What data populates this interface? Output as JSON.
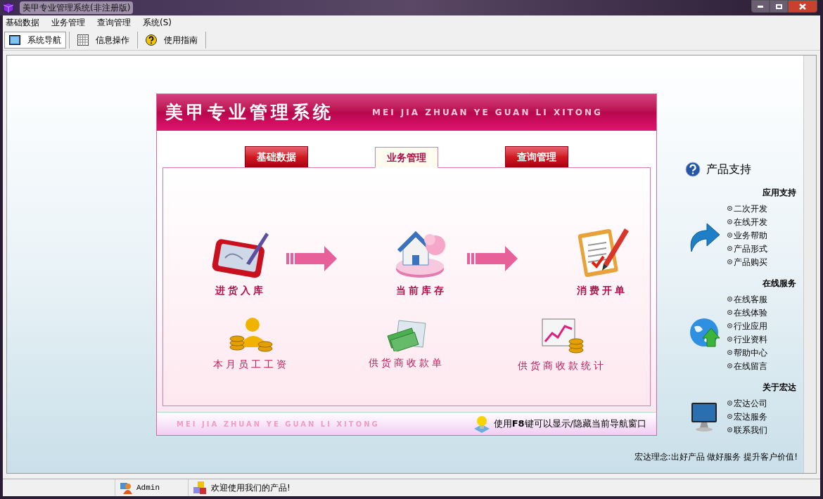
{
  "window": {
    "title": "美甲专业管理系统(非注册版)"
  },
  "menu_bar": [
    "基础数据",
    "业务管理",
    "查询管理",
    "系统(S)"
  ],
  "toolbar": [
    {
      "label": "系统导航",
      "kind": "window",
      "selected": true
    },
    {
      "label": "信息操作",
      "kind": "grid",
      "selected": false
    },
    {
      "label": "使用指南",
      "kind": "help",
      "selected": false
    }
  ],
  "panel": {
    "title": "美甲专业管理系统",
    "title_pinyin": "MEI JIA ZHUAN YE GUAN LI XITONG",
    "tabs": [
      {
        "label": "基础数据",
        "selected": false
      },
      {
        "label": "业务管理",
        "selected": true
      },
      {
        "label": "查询管理",
        "selected": false
      }
    ],
    "flow": [
      {
        "label": "进货入库",
        "kind": "tablet"
      },
      {
        "label": "当前库存",
        "kind": "house"
      },
      {
        "label": "消费开单",
        "kind": "clipboard"
      }
    ],
    "shortcuts": [
      {
        "label": "本月员工工资",
        "kind": "coins"
      },
      {
        "label": "供货商收款单",
        "kind": "cash"
      },
      {
        "label": "供货商收款统计",
        "kind": "chart"
      }
    ],
    "footer_pinyin": "MEI JIA ZHUAN YE GUAN LI XITONG",
    "hint": "使用**F8**键可以显示/隐藏当前导航窗口"
  },
  "sidebar": {
    "title": "产品支持",
    "groups": [
      {
        "heading": "应用支持",
        "kind": "arrow",
        "links": [
          "二次开发",
          "在线开发",
          "业务帮助",
          "产品形式",
          "产品购买"
        ]
      },
      {
        "heading": "在线服务",
        "kind": "globe",
        "links": [
          "在线客服",
          "在线体验",
          "行业应用",
          "行业资料",
          "帮助中心",
          "在线留言"
        ]
      },
      {
        "heading": "关于宏达",
        "kind": "monitor",
        "links": [
          "宏达公司",
          "宏达服务",
          "联系我们"
        ]
      }
    ],
    "slogan": "宏达理念:出好产品 做好服务 提升客户价值!"
  },
  "status_bar": {
    "user": "Admin",
    "message": "欢迎使用我们的产品!"
  }
}
